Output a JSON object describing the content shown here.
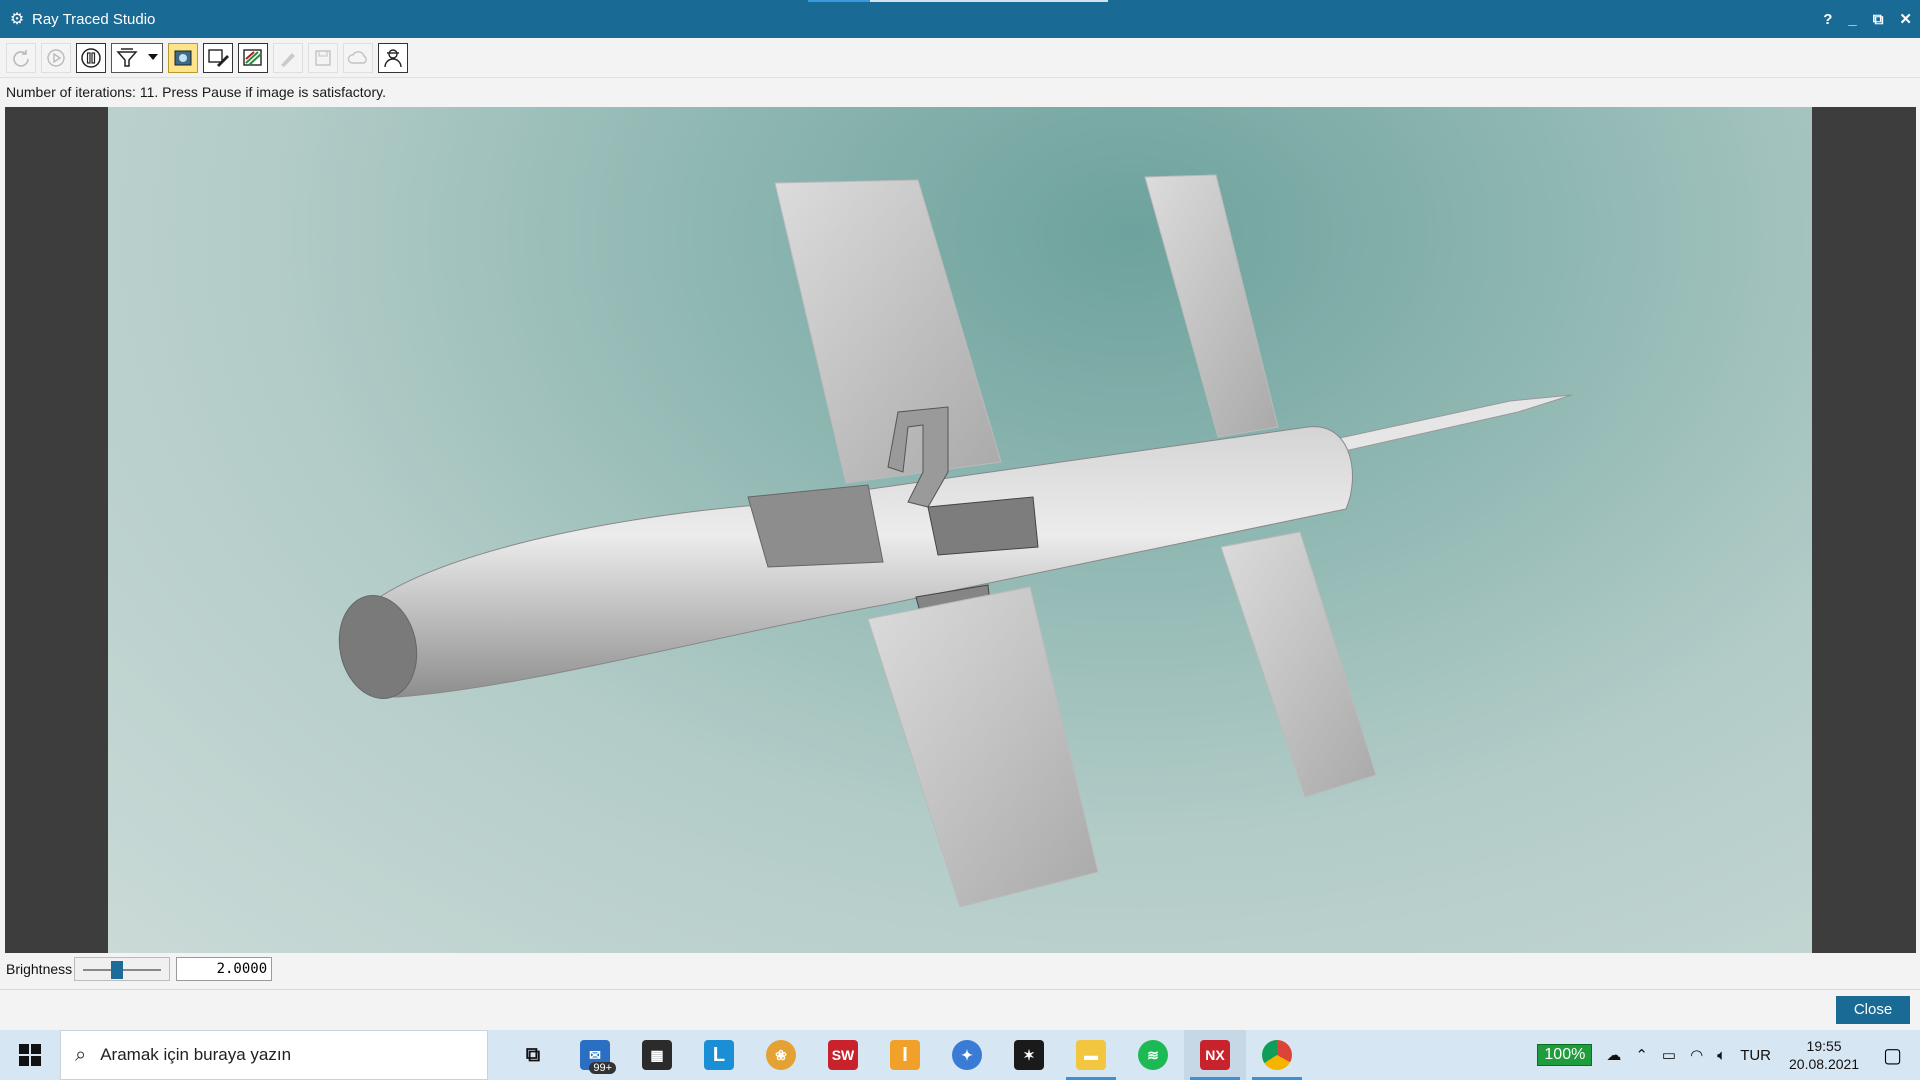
{
  "window": {
    "icon": "gear-icon",
    "title": "Ray Traced Studio",
    "controls": [
      "?",
      "_",
      "⧉",
      "✕"
    ]
  },
  "toolbar": {
    "buttons": [
      "restart-icon",
      "play-icon",
      "pause-icon",
      "filter-dropdown",
      "display-icon",
      "edit-icon",
      "slides-icon",
      "paint-icon",
      "save-icon",
      "cloud-icon",
      "user-icon"
    ]
  },
  "status": {
    "text": "Number of iterations: 11.  Press Pause if image is satisfactory."
  },
  "brightness": {
    "label": "Brightness",
    "slider_value": 0.4,
    "value": "2.0000"
  },
  "close_label": "Close",
  "taskbar": {
    "search_placeholder": "Aramak için buraya yazın",
    "mail_badge": "99+",
    "apps": [
      {
        "name": "task-view",
        "label": ""
      },
      {
        "name": "mail",
        "label": ""
      },
      {
        "name": "store",
        "label": ""
      },
      {
        "name": "l-app",
        "label": "L"
      },
      {
        "name": "fruit-app",
        "label": ""
      },
      {
        "name": "solidworks",
        "label": "SW"
      },
      {
        "name": "inventor",
        "label": "I"
      },
      {
        "name": "bird-app",
        "label": ""
      },
      {
        "name": "dassault-app",
        "label": ""
      },
      {
        "name": "explorer",
        "label": ""
      },
      {
        "name": "spotify",
        "label": ""
      },
      {
        "name": "nx",
        "label": "NX"
      },
      {
        "name": "chrome",
        "label": ""
      }
    ],
    "battery": "100%",
    "lang": "TUR",
    "time": "19:55",
    "date": "20.08.2021"
  }
}
